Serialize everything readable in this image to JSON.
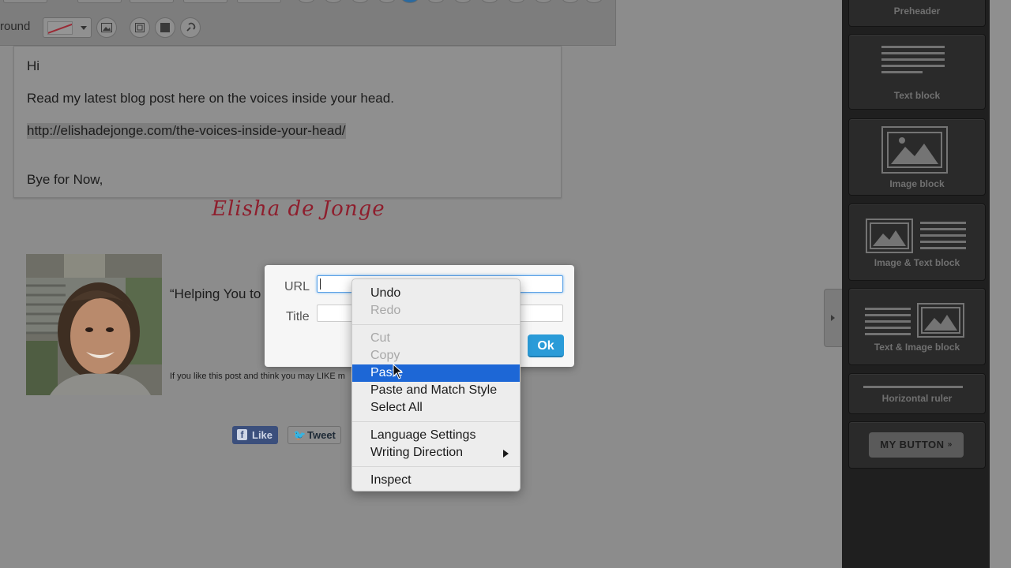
{
  "toolbar": {
    "background_label": "round",
    "bg_color_swatch": "#9a2a35",
    "icons": [
      "image-icon",
      "border-icon",
      "block-style-icon",
      "link-icon"
    ]
  },
  "content": {
    "greeting": "Hi",
    "body": "Read my latest blog post here on the voices inside your head.",
    "link": "http://elishadejonge.com/the-voices-inside-your-head/",
    "closing": "Bye for Now,",
    "signature": "Elisha de Jonge",
    "tagline": "“Helping You to",
    "small_text": "If you like this post and think you may LIKE m",
    "social": {
      "like_label": "Like",
      "tweet_label": "Tweet"
    }
  },
  "link_dialog": {
    "url_label": "URL",
    "title_label": "Title",
    "url_value": "",
    "title_value": "",
    "ok_label": "Ok",
    "accent": "#2a9bd8"
  },
  "context_menu": {
    "items": [
      {
        "label": "Undo",
        "enabled": true
      },
      {
        "label": "Redo",
        "enabled": false
      },
      {
        "label": "Cut",
        "enabled": false
      },
      {
        "label": "Copy",
        "enabled": false
      },
      {
        "label": "Paste",
        "enabled": true,
        "highlighted": true
      },
      {
        "label": "Paste and Match Style",
        "enabled": true
      },
      {
        "label": "Select All",
        "enabled": true
      },
      {
        "label": "Language Settings",
        "enabled": true
      },
      {
        "label": "Writing Direction",
        "enabled": true,
        "submenu": true
      },
      {
        "label": "Inspect",
        "enabled": true
      }
    ],
    "highlight_color": "#1d67d6"
  },
  "blocks_panel": {
    "preheader": "Preheader",
    "text_block": "Text block",
    "image_block": "Image block",
    "image_text_block": "Image & Text block",
    "text_image_block": "Text & Image block",
    "horizontal_ruler": "Horizontal ruler",
    "my_button": "MY BUTTON",
    "my_button_suffix": "»"
  }
}
